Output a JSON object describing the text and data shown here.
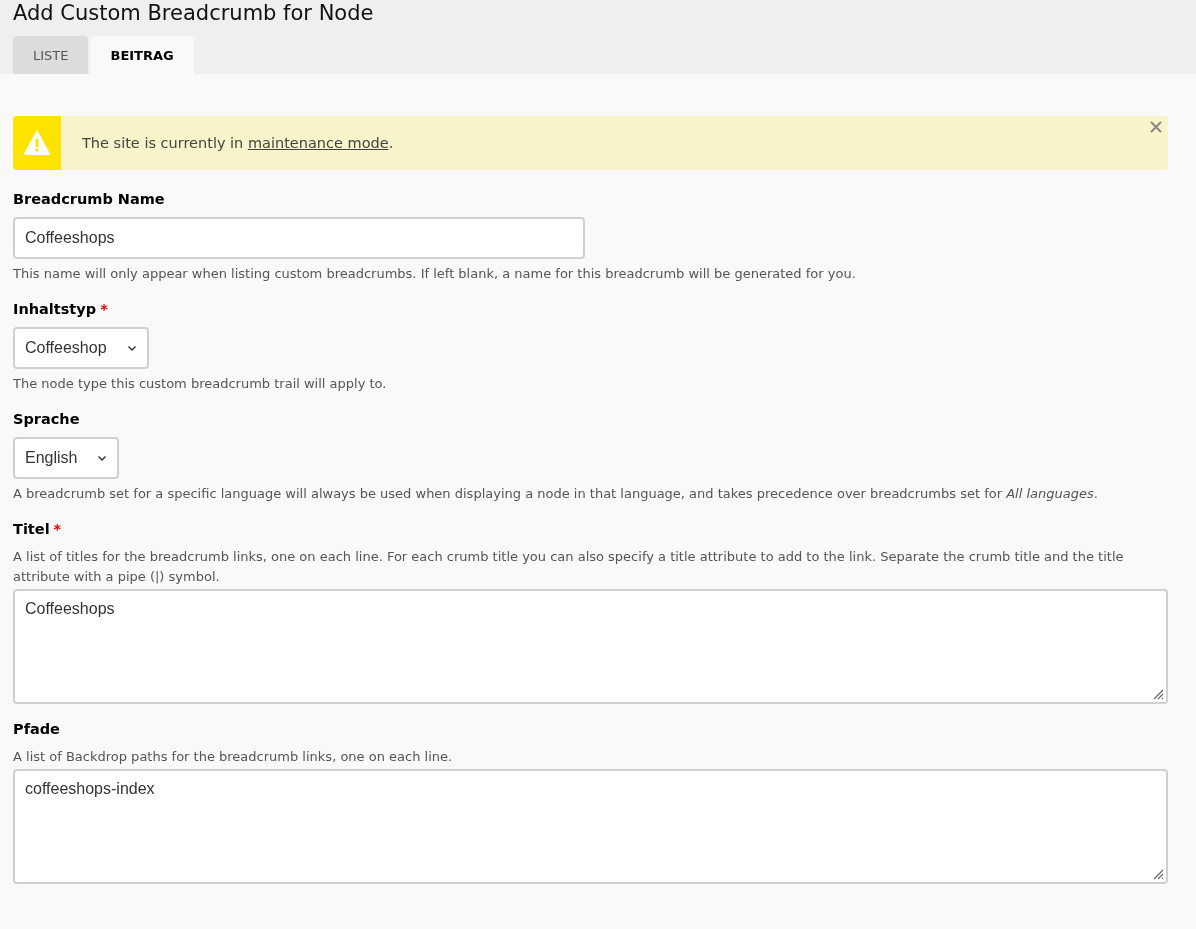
{
  "page_title": "Add Custom Breadcrumb for Node",
  "tabs": [
    {
      "label": "LISTE",
      "selected": false
    },
    {
      "label": "BEITRAG",
      "selected": true
    }
  ],
  "notice": {
    "text_before": "The site is currently in ",
    "link": "maintenance mode",
    "text_after": "."
  },
  "fields": [
    {
      "kind": "text",
      "label": "Breadcrumb Name",
      "value": "Coffeeshops",
      "description": "This name will only appear when listing custom breadcrumbs. If left blank, a name for this breadcrumb will be generated for you."
    },
    {
      "kind": "select",
      "label": "Inhaltstyp",
      "required_mark": "*",
      "value": "Coffeeshop",
      "description": "The node type this custom breadcrumb trail will apply to."
    },
    {
      "kind": "select",
      "label": "Sprache",
      "value": "English",
      "description": "A breadcrumb set for a specific language will always be used when displaying a node in that language, and takes precedence over breadcrumbs set for *All languages*."
    },
    {
      "kind": "textarea",
      "label": "Titel",
      "required_mark": "*",
      "value": "Coffeeshops",
      "description": "A list of titles for the breadcrumb links, one on each line. For each crumb title you can also specify a title attribute to add to the link. Separate the crumb title and the title attribute with a pipe (|) symbol."
    },
    {
      "kind": "textarea",
      "label": "Pfade",
      "value": "coffeeshops-index",
      "description": "A list of Backdrop paths for the breadcrumb links, one on each line."
    }
  ]
}
